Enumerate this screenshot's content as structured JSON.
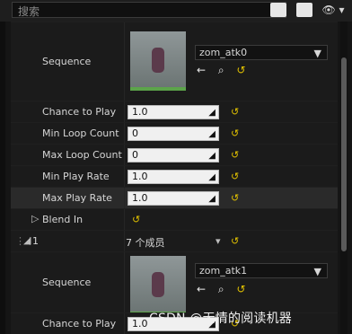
{
  "search": {
    "placeholder": "搜索"
  },
  "topbar": {
    "grid_icon": "grid-icon",
    "eye_icon": "eye-icon"
  },
  "sequence1": {
    "label": "Sequence",
    "name": "zom_atk0",
    "tools": [
      "←",
      "⌕",
      "↺"
    ]
  },
  "params1": [
    {
      "label": "Chance to Play",
      "value": "1.0"
    },
    {
      "label": "Min Loop Count",
      "value": "0"
    },
    {
      "label": "Max Loop Count",
      "value": "0"
    },
    {
      "label": "Min Play Rate",
      "value": "1.0"
    },
    {
      "label": "Max Play Rate",
      "value": "1.0"
    }
  ],
  "blend_in": {
    "label": "Blend In"
  },
  "group": {
    "index": "1",
    "members": "7 个成员"
  },
  "sequence2": {
    "label": "Sequence",
    "name": "zom_atk1",
    "tools": [
      "←",
      "⌕",
      "↺"
    ]
  },
  "params2": [
    {
      "label": "Chance to Play",
      "value": "1.0"
    }
  ],
  "watermark": "CSDN @无情的阅读机器"
}
